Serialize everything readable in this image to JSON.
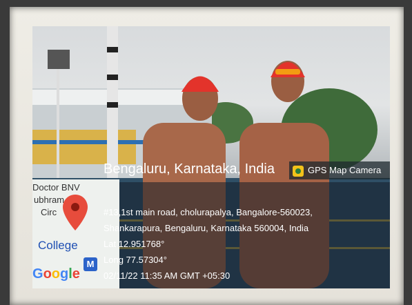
{
  "map": {
    "label_1": "Doctor BNV",
    "label_2": "ubhram",
    "label_3": "Circ",
    "college": "College",
    "m_badge": "M",
    "google": [
      "G",
      "o",
      "o",
      "g",
      "l",
      "e"
    ],
    "google_colors": [
      "#4285F4",
      "#EA4335",
      "#FBBC05",
      "#4285F4",
      "#34A853",
      "#EA4335"
    ]
  },
  "badge": {
    "text": "GPS Map Camera"
  },
  "location": {
    "title": "Bengaluru, Karnataka, India",
    "address_1": "#13,1st main road, cholurapalya, Bangalore-560023,",
    "address_2": "Shankarapura, Bengaluru, Karnataka 560004, India",
    "lat": "Lat 12.951768°",
    "long": "Long 77.57304°",
    "timestamp": "02/11/22 11:35 AM GMT +05:30"
  },
  "colors": {
    "cap": "#e3332b",
    "pin": "#e74c3c",
    "pool": "#2f4f66"
  }
}
